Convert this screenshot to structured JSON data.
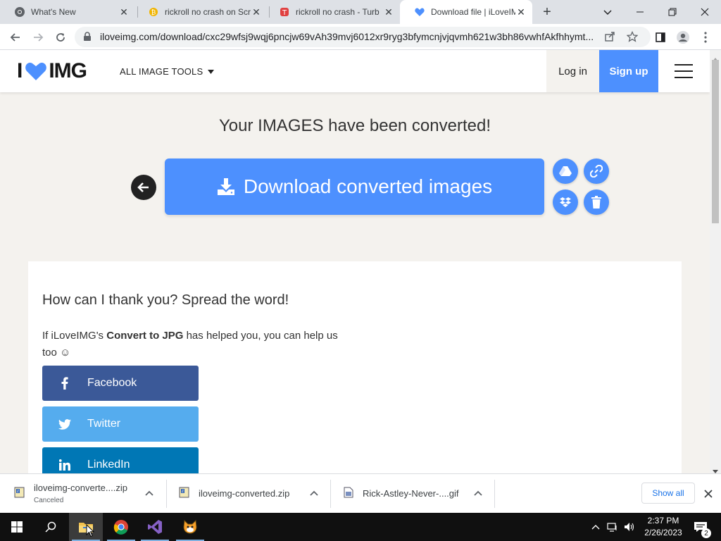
{
  "browser": {
    "tabs": [
      {
        "title": "What's New",
        "icon": "chrome-icon"
      },
      {
        "title": "rickroll no crash on Scr",
        "icon": "scratch-coin-icon"
      },
      {
        "title": "rickroll no crash - Turb",
        "icon": "turbowarp-icon"
      },
      {
        "title": "Download file | iLoveIM",
        "icon": "iloveimg-heart-icon",
        "active": true
      }
    ],
    "new_tab_glyph": "+",
    "url": "iloveimg.com/download/cxc29wfsj9wqj6pncjw69vAh39mvj6012xr9ryg3bfymcnjvjqvmh621w3bh86vwhfAkfhhymt..."
  },
  "site": {
    "logo_left": "I",
    "logo_right": "IMG",
    "tools_menu": "ALL IMAGE TOOLS",
    "login": "Log in",
    "signup": "Sign up",
    "brand_color": "#4d90fe"
  },
  "main": {
    "headline": "Your IMAGES have been converted!",
    "download_label": "Download converted images"
  },
  "share_card": {
    "title": "How can I thank you? Spread the word!",
    "text_before": "If iLoveIMG's ",
    "text_bold": "Convert to JPG",
    "text_after": " has helped you, you can help us too ☺",
    "buttons": [
      {
        "label": "Facebook",
        "color": "#3b5998"
      },
      {
        "label": "Twitter",
        "color": "#55acee"
      },
      {
        "label": "LinkedIn",
        "color": "#0077b5"
      }
    ]
  },
  "downloads": {
    "items": [
      {
        "name": "iloveimg-converte....zip",
        "status": "Canceled"
      },
      {
        "name": "iloveimg-converted.zip",
        "status": ""
      },
      {
        "name": "Rick-Astley-Never-....gif",
        "status": ""
      }
    ],
    "show_all": "Show all"
  },
  "taskbar": {
    "time": "2:37 PM",
    "date": "2/26/2023",
    "notification_count": "2"
  }
}
